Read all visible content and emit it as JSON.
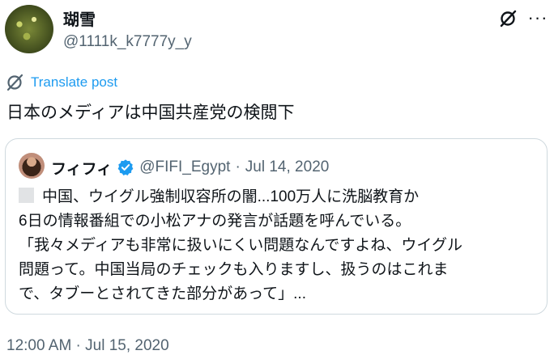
{
  "author": {
    "name": "瑚雪",
    "handle": "@1111k_k7777y_y"
  },
  "actions": {
    "grok_icon": "grok-icon",
    "more_label": "···"
  },
  "translate": {
    "label": "Translate post"
  },
  "post": {
    "text": "日本のメディアは中国共産党の検閲下"
  },
  "quote": {
    "name": "フィフィ",
    "handle": "@FIFI_Egypt",
    "separator": "·",
    "date": "Jul 14, 2020",
    "lines": [
      "中国、ウイグル強制収容所の闇...100万人に洗脳教育か",
      "6日の情報番組での小松アナの発言が話題を呼んでいる。",
      "「我々メディアも非常に扱いにくい問題なんですよね、ウイグル",
      "問題って。中国当局のチェックも入りますし、扱うのはこれま",
      "で、タブーとされてきた部分があって」..."
    ]
  },
  "meta": {
    "timestamp": "12:00 AM · Jul 15, 2020"
  },
  "colors": {
    "accent": "#1d9bf0",
    "secondary_text": "#536471",
    "border": "#cfd9de"
  }
}
